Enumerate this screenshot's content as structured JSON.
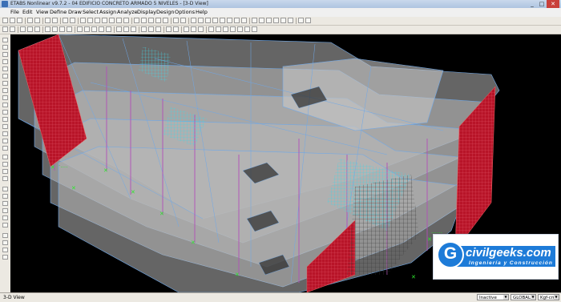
{
  "window": {
    "title": "ETABS Nonlinear v9.7.2 - 04 EDIFICIO CONCRETO ARMADO 5 NIVELES - [3-D View]",
    "minimize": "_",
    "maximize": "□",
    "close": "✕"
  },
  "menu": [
    "File",
    "Edit",
    "View",
    "Define",
    "Draw",
    "Select",
    "Assign",
    "Analyze",
    "Display",
    "Design",
    "Options",
    "Help"
  ],
  "view": {
    "mode": "3-D View"
  },
  "status": {
    "text": "3-D View",
    "view_state": "Inactive",
    "coord_system": "GLOBAL",
    "units": "Kgf-cm"
  },
  "logo": {
    "name": "civilgeeks.com",
    "tagline": "Ingeniería y Construcción",
    "letter": "G"
  },
  "colors": {
    "background": "#000000",
    "slab": "#b4b4b4",
    "grid_lines": "#6fa8e8",
    "shear_wall": "#c0182b",
    "columns": "#b24fb8",
    "stairs": "#48d0e0",
    "supports": "#2ee62e",
    "brand": "#1d7bd8"
  }
}
